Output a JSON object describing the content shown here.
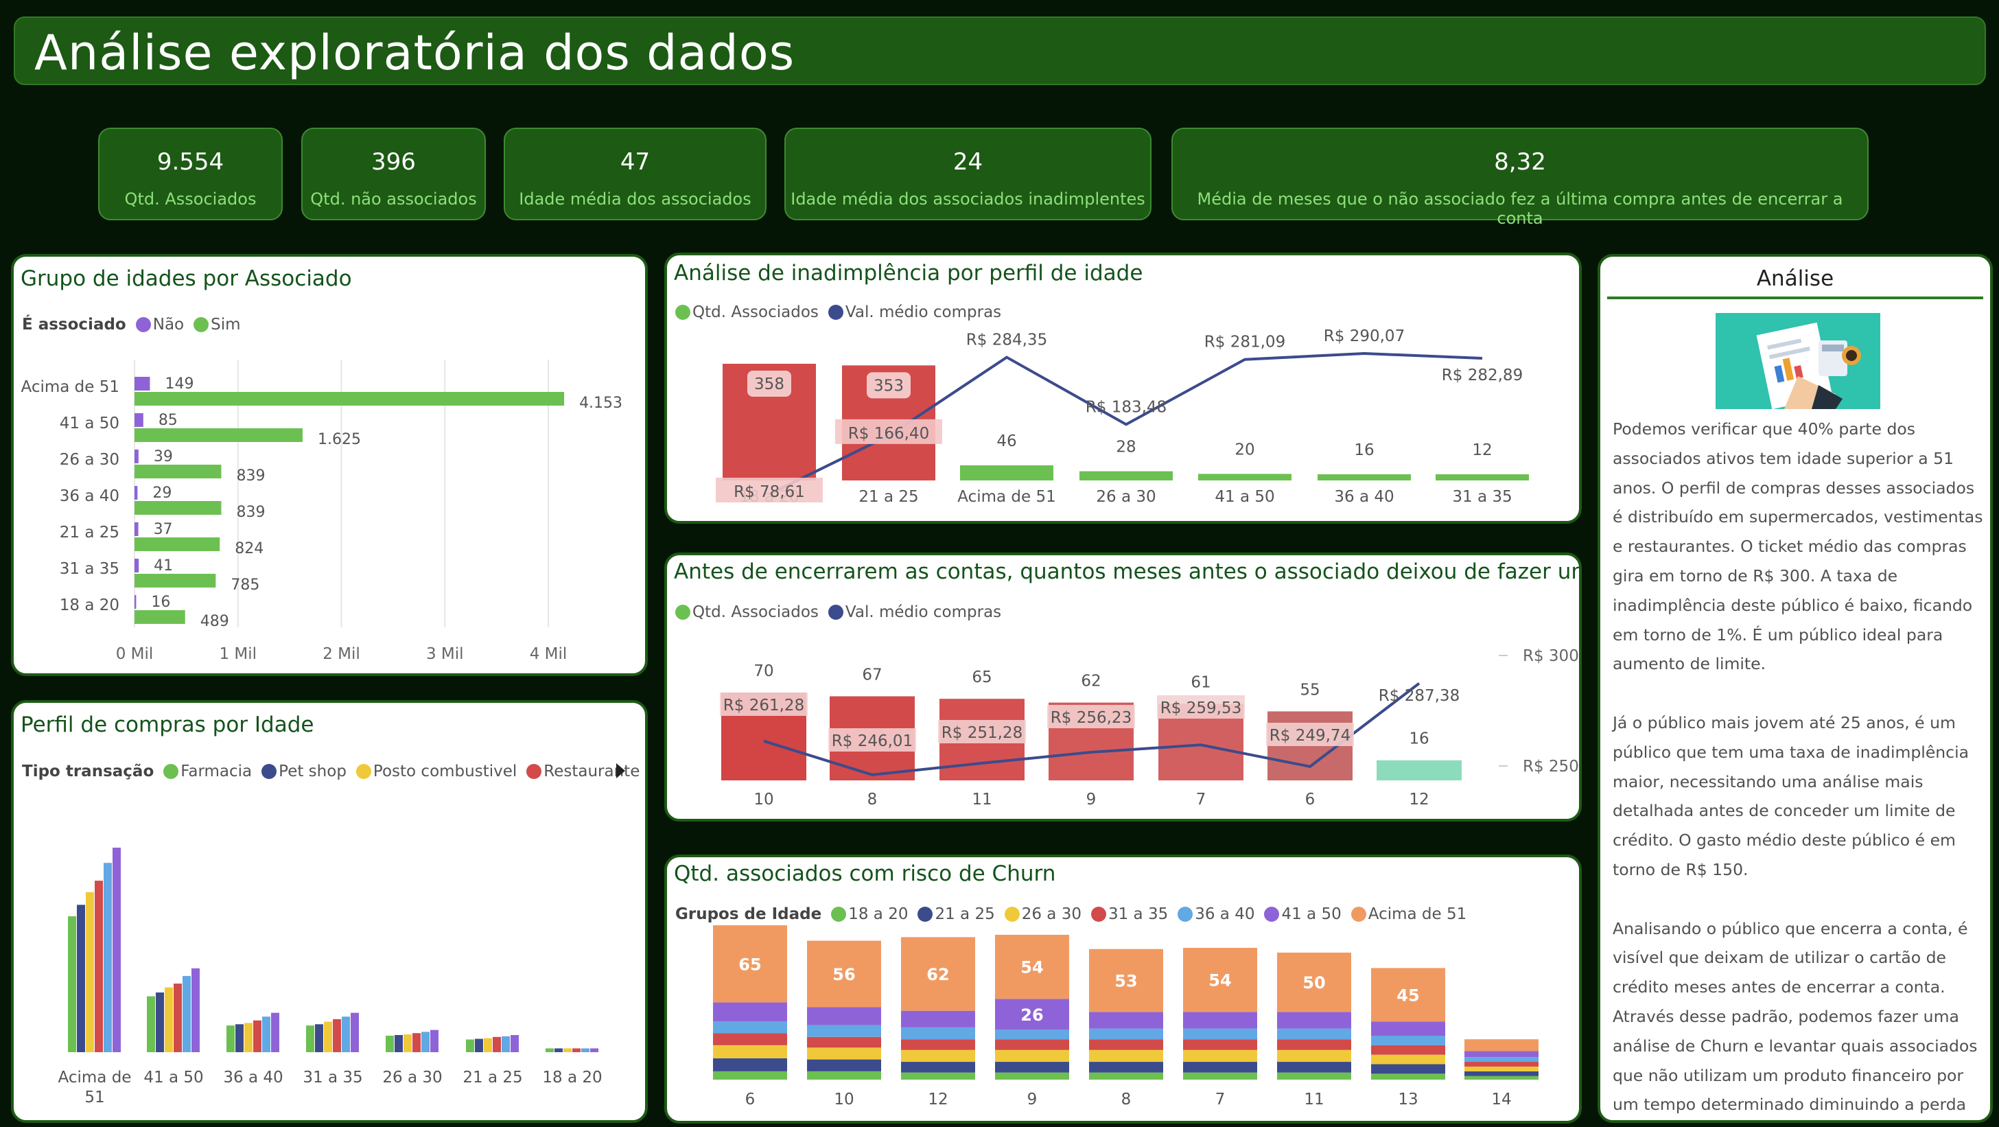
{
  "page_title": "Análise exploratória dos dados",
  "kpis": [
    {
      "value": "9.554",
      "label": "Qtd. Associados"
    },
    {
      "value": "396",
      "label": "Qtd. não associados"
    },
    {
      "value": "47",
      "label": "Idade média dos associados"
    },
    {
      "value": "24",
      "label": "Idade média dos associados inadimplentes"
    },
    {
      "value": "8,32",
      "label": "Média de meses que o não associado fez a última compra antes de encerrar a conta"
    }
  ],
  "colors": {
    "header_bg": "#1d5a14",
    "nao": "#8f63d8",
    "sim": "#6cc052",
    "bar_red": "#d24a4a",
    "line_blue": "#3c4b8c",
    "churn_12": "#8cdcbc",
    "idade": [
      "#6cc052",
      "#3c4b8c",
      "#f0c93a",
      "#d24a4a",
      "#62a8e4",
      "#8f63d8",
      "#f09a62"
    ]
  },
  "panel_age_group": {
    "title": "Grupo de idades por Associado",
    "legend_title": "É associado",
    "legend": [
      {
        "name": "Não",
        "color": "#8f63d8"
      },
      {
        "name": "Sim",
        "color": "#6cc052"
      }
    ],
    "x_ticks": [
      "0 Mil",
      "1 Mil",
      "2 Mil",
      "3 Mil",
      "4 Mil"
    ]
  },
  "panel_purchase_profile": {
    "title": "Perfil de compras por Idade",
    "legend_title": "Tipo transação",
    "legend": [
      {
        "name": "Farmacia",
        "color": "#6cc052"
      },
      {
        "name": "Pet shop",
        "color": "#3c4b8c"
      },
      {
        "name": "Posto combustivel",
        "color": "#f0c93a"
      },
      {
        "name": "Restaurante",
        "color": "#d24a4a"
      }
    ],
    "more_icon": "chevron-right-icon"
  },
  "panel_default": {
    "title": "Análise de inadimplência por perfil de idade",
    "legend": [
      {
        "name": "Qtd. Associados",
        "color": "#6cc052"
      },
      {
        "name": "Val. médio compras",
        "color": "#3c4b8c"
      }
    ]
  },
  "panel_months": {
    "title": "Antes de encerrarem as contas, quantos meses antes o associado deixou de fazer uma compra?",
    "legend": [
      {
        "name": "Qtd. Associados",
        "color": "#6cc052"
      },
      {
        "name": "Val. médio compras",
        "color": "#3c4b8c"
      }
    ],
    "right_axis": [
      "R$ 300",
      "R$ 250"
    ]
  },
  "panel_churn": {
    "title": "Qtd. associados com risco de Churn",
    "legend_title": "Grupos de Idade",
    "legend": [
      {
        "name": "18 a 20",
        "color": "#6cc052"
      },
      {
        "name": "21 a 25",
        "color": "#3c4b8c"
      },
      {
        "name": "26 a 30",
        "color": "#f0c93a"
      },
      {
        "name": "31 a 35",
        "color": "#d24a4a"
      },
      {
        "name": "36 a 40",
        "color": "#62a8e4"
      },
      {
        "name": "41 a 50",
        "color": "#8f63d8"
      },
      {
        "name": "Acima de 51",
        "color": "#f09a62"
      }
    ]
  },
  "analysis": {
    "title": "Análise",
    "image_icon": "document-analysis-icon",
    "paragraphs": [
      "Podemos verificar que 40% parte dos associados ativos tem idade superior a 51 anos. O perfil de compras desses associados é distribuído em supermercados, vestimentas e restaurantes. O ticket médio das compras gira em torno de R$ 300. A taxa de inadimplência deste público é baixo, ficando em torno de 1%. É um público ideal para aumento de limite.",
      "Já o público mais jovem até 25 anos, é um público que tem uma taxa de inadimplência maior, necessitando uma análise mais detalhada antes de conceder um limite de crédito. O gasto médio deste público é em torno de R$ 150.",
      "Analisando o público que encerra a conta, é visível que deixam de utilizar o cartão de crédito meses antes de encerrar a conta. Através desse padrão, podemos fazer uma análise de Churn e levantar quais associados que não utilizam um produto financeiro por um tempo determinado diminuindo a perda desse associado."
    ]
  },
  "chart_data": [
    {
      "type": "bar",
      "orientation": "horizontal",
      "title": "Grupo de idades por Associado",
      "categories": [
        "Acima de 51",
        "41 a 50",
        "26 a 30",
        "36 a 40",
        "21 a 25",
        "31 a 35",
        "18 a 20"
      ],
      "series": [
        {
          "name": "Não",
          "values": [
            149,
            85,
            39,
            29,
            37,
            41,
            16
          ]
        },
        {
          "name": "Sim",
          "values": [
            4153,
            1625,
            839,
            839,
            824,
            785,
            489
          ]
        }
      ],
      "labels": {
        "Não": [
          "149",
          "85",
          "39",
          "29",
          "37",
          "41",
          "16"
        ],
        "Sim": [
          "4.153",
          "1.625",
          "839",
          "839",
          "824",
          "785",
          "489"
        ]
      },
      "xlim": [
        0,
        4500
      ],
      "x_ticks": [
        0,
        1000,
        2000,
        3000,
        4000
      ],
      "grid": true,
      "legend_position": "top-left"
    },
    {
      "type": "bar",
      "title": "Perfil de compras por Idade",
      "categories": [
        "Acima de 51",
        "41 a 50",
        "36 a 40",
        "31 a 35",
        "26 a 30",
        "21 a 25",
        "18 a 20"
      ],
      "category_lines": [
        [
          "Acima de",
          "51"
        ],
        [
          "41 a 50"
        ],
        [
          "36 a 40"
        ],
        [
          "31 a 35"
        ],
        [
          "26 a 30"
        ],
        [
          "21 a 25"
        ],
        [
          "18 a 20"
        ]
      ],
      "series": [
        {
          "name": "Farmacia",
          "values": [
            1070,
            440,
            210,
            210,
            130,
            100,
            30
          ]
        },
        {
          "name": "Pet shop",
          "values": [
            1160,
            470,
            220,
            220,
            135,
            105,
            30
          ]
        },
        {
          "name": "Posto combustivel",
          "values": [
            1260,
            510,
            230,
            240,
            140,
            110,
            30
          ]
        },
        {
          "name": "Restaurante",
          "values": [
            1350,
            540,
            250,
            260,
            150,
            120,
            30
          ]
        },
        {
          "name": "",
          "values": [
            1490,
            600,
            280,
            280,
            160,
            125,
            30
          ]
        },
        {
          "name": "",
          "values": [
            1610,
            660,
            310,
            310,
            175,
            135,
            30
          ]
        }
      ],
      "legend_position": "top-left"
    },
    {
      "type": "bar+line",
      "title": "Análise de inadimplência por perfil de idade",
      "categories": [
        "18 a 20",
        "21 a 25",
        "Acima de 51",
        "26 a 30",
        "41 a 50",
        "36 a 40",
        "31 a 35"
      ],
      "series": [
        {
          "name": "Qtd. Associados",
          "values": [
            358,
            353,
            46,
            28,
            20,
            16,
            12
          ]
        },
        {
          "name": "Val. médio compras",
          "values": [
            78.61,
            166.4,
            284.35,
            183.48,
            281.09,
            290.07,
            282.89
          ]
        }
      ],
      "labels": {
        "Qtd. Associados": [
          "358",
          "353",
          "46",
          "28",
          "20",
          "16",
          "12"
        ],
        "Val. médio compras": [
          "R$ 78,61",
          "R$ 166,40",
          "R$ 284,35",
          "R$ 183,48",
          "R$ 281,09",
          "R$ 290,07",
          "R$ 282,89"
        ]
      }
    },
    {
      "type": "bar+line",
      "title": "Antes de encerrarem as contas, quantos meses antes o associado deixou de fazer uma compra?",
      "categories": [
        "10",
        "8",
        "11",
        "9",
        "7",
        "6",
        "12"
      ],
      "series": [
        {
          "name": "Qtd. Associados",
          "values": [
            70,
            67,
            65,
            62,
            61,
            55,
            16
          ]
        },
        {
          "name": "Val. médio compras",
          "values": [
            261.28,
            246.01,
            251.28,
            256.23,
            259.53,
            249.74,
            287.38
          ]
        }
      ],
      "labels": {
        "Qtd. Associados": [
          "70",
          "67",
          "65",
          "62",
          "61",
          "55",
          "16"
        ],
        "Val. médio compras": [
          "R$ 261,28",
          "R$ 246,01",
          "R$ 251,28",
          "R$ 256,23",
          "R$ 259,53",
          "R$ 249,74",
          "R$ 287,38"
        ]
      },
      "y2_ticks": [
        300,
        250
      ],
      "y2_tick_labels": [
        "R$ 300",
        "R$ 250"
      ]
    },
    {
      "type": "bar",
      "stacked": true,
      "title": "Qtd. associados com risco de Churn",
      "categories": [
        "6",
        "10",
        "12",
        "9",
        "8",
        "7",
        "11",
        "13",
        "14"
      ],
      "series": [
        {
          "name": "18 a 20",
          "values": [
            7,
            7,
            6,
            6,
            6,
            6,
            6,
            5,
            3
          ]
        },
        {
          "name": "21 a 25",
          "values": [
            11,
            10,
            9,
            9,
            9,
            9,
            9,
            8,
            4
          ]
        },
        {
          "name": "26 a 30",
          "values": [
            11,
            10,
            10,
            10,
            10,
            10,
            10,
            8,
            4
          ]
        },
        {
          "name": "31 a 35",
          "values": [
            10,
            9,
            9,
            9,
            9,
            9,
            9,
            8,
            4
          ]
        },
        {
          "name": "36 a 40",
          "values": [
            10,
            10,
            10,
            8,
            9,
            9,
            9,
            8,
            4
          ]
        },
        {
          "name": "41 a 50",
          "values": [
            16,
            15,
            14,
            26,
            14,
            14,
            14,
            12,
            5
          ]
        },
        {
          "name": "Acima de 51",
          "values": [
            65,
            56,
            62,
            54,
            53,
            54,
            50,
            45,
            10
          ]
        }
      ],
      "labels": {
        "41 a 50": [
          "",
          "",
          "",
          "26",
          "",
          "",
          "",
          "",
          ""
        ],
        "Acima de 51": [
          "65",
          "56",
          "62",
          "54",
          "53",
          "54",
          "50",
          "45",
          ""
        ]
      }
    }
  ]
}
